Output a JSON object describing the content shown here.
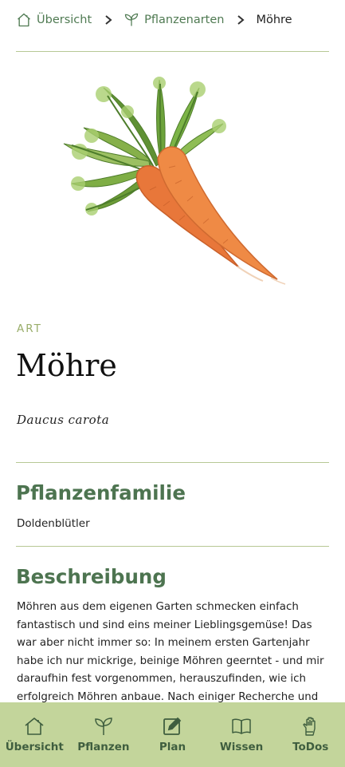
{
  "breadcrumb": {
    "home_label": "Übersicht",
    "section_label": "Pflanzenarten",
    "current_label": "Möhre"
  },
  "plant": {
    "kind_label": "ART",
    "name": "Möhre",
    "latin_name": "Daucus carota",
    "image_icon": "carrot-illustration"
  },
  "family": {
    "heading": "Pflanzenfamilie",
    "value": "Doldenblütler"
  },
  "description": {
    "heading": "Beschreibung",
    "text": "Möhren aus dem eigenen Garten schmecken einfach fantastisch und sind eins meiner Lieblingsgemüse! Das war aber nicht immer so: In meinem ersten Gartenjahr habe ich nur mickrige, beinige Möhren geerntet - und mir daraufhin fest vorgenommen, herauszufinden, wie ich erfolgreich Möhren anbaue. Nach einiger Recherche und noch mehr"
  },
  "tabbar": {
    "items": [
      {
        "label": "Übersicht",
        "icon": "house-icon"
      },
      {
        "label": "Pflanzen",
        "icon": "sprout-icon"
      },
      {
        "label": "Plan",
        "icon": "edit-icon"
      },
      {
        "label": "Wissen",
        "icon": "book-icon"
      },
      {
        "label": "ToDos",
        "icon": "glove-icon"
      }
    ]
  },
  "colors": {
    "accent_green": "#4d7450",
    "light_green": "#c3d59b",
    "divider": "#b7c895",
    "carrot_orange": "#e8773a"
  }
}
